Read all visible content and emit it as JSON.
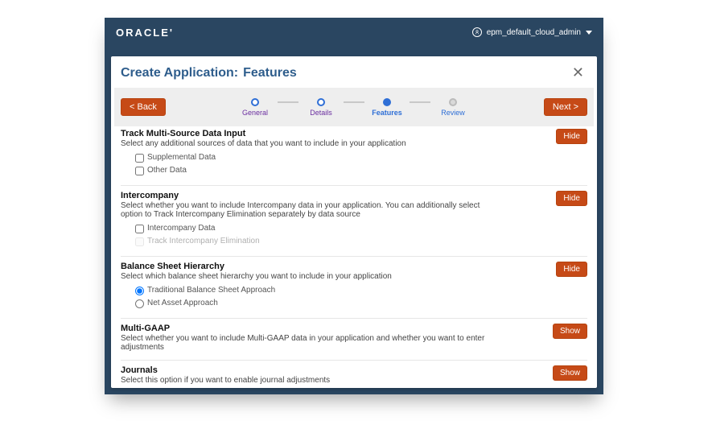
{
  "brand": "ORACLE'",
  "user": {
    "label": "epm_default_cloud_admin"
  },
  "dialog": {
    "title_prefix": "Create Application:",
    "title_current": "Features",
    "close": "✕"
  },
  "wizard": {
    "back": "< Back",
    "next": "Next >",
    "steps": [
      {
        "label": "General"
      },
      {
        "label": "Details"
      },
      {
        "label": "Features"
      },
      {
        "label": "Review"
      }
    ]
  },
  "sections": {
    "trackMulti": {
      "title": "Track Multi-Source Data Input",
      "desc": "Select any additional sources of data that you want to include in your application",
      "toggle": "Hide",
      "opts": [
        {
          "label": "Supplemental Data"
        },
        {
          "label": "Other Data"
        }
      ]
    },
    "intercompany": {
      "title": "Intercompany",
      "desc": "Select whether you want to include Intercompany data in your application. You can additionally select option to Track Intercompany Elimination separately by data source",
      "toggle": "Hide",
      "opts": [
        {
          "label": "Intercompany Data"
        },
        {
          "label": "Track Intercompany Elimination"
        }
      ]
    },
    "balanceSheet": {
      "title": "Balance Sheet Hierarchy",
      "desc": "Select which balance sheet hierarchy you want to include in your application",
      "toggle": "Hide",
      "opts": [
        {
          "label": "Traditional Balance Sheet Approach"
        },
        {
          "label": "Net Asset Approach"
        }
      ]
    },
    "multiGaap": {
      "title": "Multi-GAAP",
      "desc": "Select whether you want to include Multi-GAAP data in your application and whether you want to enter adjustments",
      "toggle": "Show"
    },
    "journals": {
      "title": "Journals",
      "desc": "Select this option if you want to enable journal adjustments",
      "toggle": "Show"
    }
  }
}
